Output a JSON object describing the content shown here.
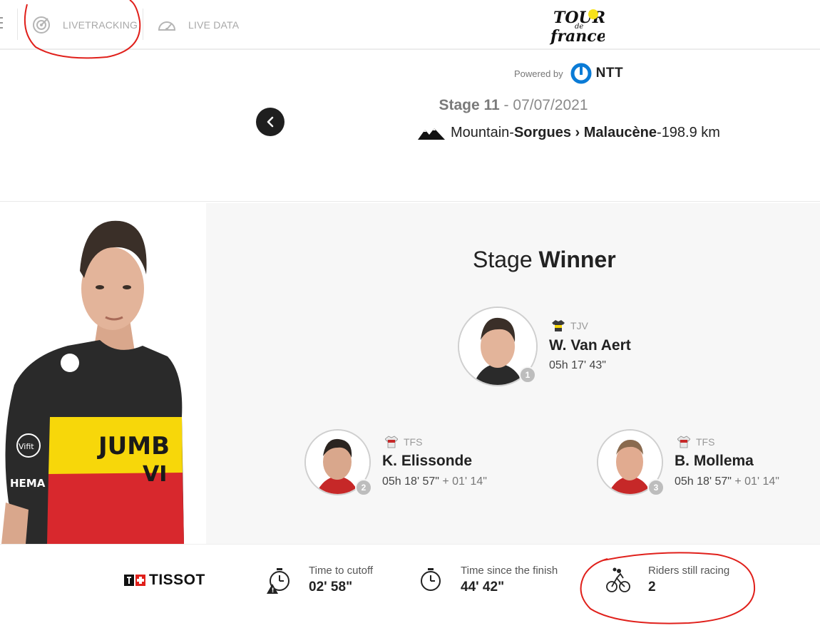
{
  "nav": {
    "items": [
      {
        "label": "LIVETRACKING",
        "icon": "radar-icon"
      },
      {
        "label": "LIVE DATA",
        "icon": "speedometer-icon"
      }
    ],
    "logo_text": "Tour de France"
  },
  "header": {
    "powered_by": "Powered by",
    "partner": "NTT",
    "stage_label": "Stage 11",
    "stage_sep": " - ",
    "stage_date": "07/07/2021",
    "stage_type": "Mountain",
    "route_sep": " - ",
    "route": "Sorgues › Malaucène",
    "distance_sep": " - ",
    "distance": "198.9 km"
  },
  "winner_section": {
    "title_light": "Stage ",
    "title_bold": "Winner",
    "riders": [
      {
        "rank": "1",
        "team": "TJV",
        "name": "W. Van Aert",
        "time": "05h 17' 43\"",
        "gap": ""
      },
      {
        "rank": "2",
        "team": "TFS",
        "name": "K. Elissonde",
        "time": "05h 18' 57\"",
        "gap": " + 01' 14\""
      },
      {
        "rank": "3",
        "team": "TFS",
        "name": "B. Mollema",
        "time": "05h 18' 57\"",
        "gap": " + 01' 14\""
      }
    ]
  },
  "footer": {
    "sponsor": "TISSOT",
    "stats": [
      {
        "label": "Time to cutoff",
        "value": "02' 58\"",
        "icon": "stopwatch-warning-icon"
      },
      {
        "label": "Time since the finish",
        "value": "44' 42\"",
        "icon": "stopwatch-icon"
      },
      {
        "label": "Riders still racing",
        "value": "2",
        "icon": "cyclists-icon"
      }
    ]
  },
  "colors": {
    "annotation": "#e0201b",
    "dark": "#1f1f1f",
    "jumbo_yellow": "#f7d70a",
    "ntt_blue": "#0a7bd6"
  }
}
